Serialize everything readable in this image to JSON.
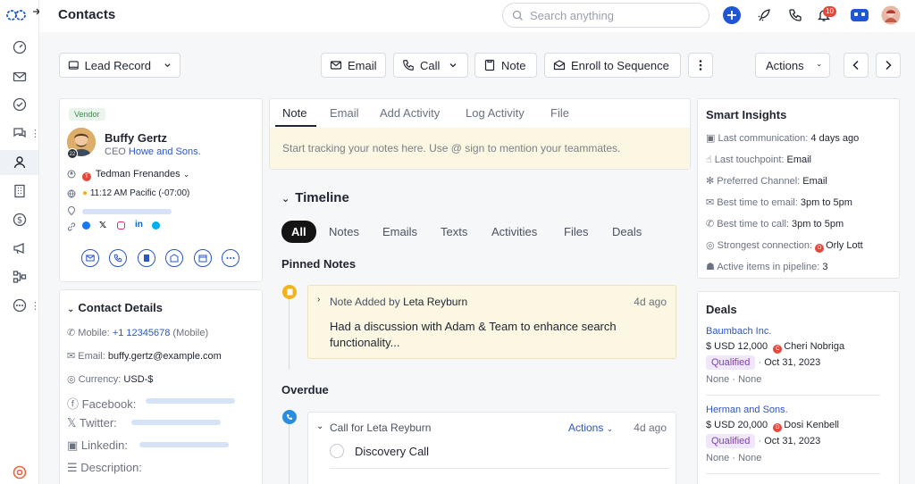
{
  "topbar": {
    "title": "Contacts",
    "search_placeholder": "Search anything",
    "notification_count": "10"
  },
  "actions": {
    "record_type": "Lead Record",
    "email": "Email",
    "call": "Call",
    "note": "Note",
    "enroll": "Enroll to Sequence",
    "actions": "Actions"
  },
  "contact": {
    "tag": "Vendor",
    "name": "Buffy Gertz",
    "title_prefix": "CEO",
    "company": "Howe and Sons.",
    "avatar_badge": "22",
    "owner_initial": "T",
    "owner": "Tedman Frenandes",
    "local_time": "11:12 AM Pacific (-07:00)"
  },
  "details": {
    "heading": "Contact Details",
    "mobile_label": "Mobile:",
    "mobile_value": "+1 12345678",
    "mobile_type": "(Mobile)",
    "email_label": "Email:",
    "email_value": "buffy.gertz@example.com",
    "currency_label": "Currency:",
    "currency_value": "USD-$",
    "facebook_label": "Facebook:",
    "twitter_label": "Twitter:",
    "linkedin_label": "Linkedin:",
    "description_label": "Description:"
  },
  "composer": {
    "tabs": [
      "Note",
      "Email",
      "Add Activity",
      "Log Activity",
      "File"
    ],
    "placeholder": "Start tracking your notes here. Use @ sign to mention your teammates."
  },
  "timeline": {
    "heading": "Timeline",
    "filters": [
      "All",
      "Notes",
      "Emails",
      "Texts",
      "Activities",
      "Files",
      "Deals"
    ],
    "pinned_heading": "Pinned Notes",
    "pinned_prefix": "Note Added by",
    "pinned_author": "Leta Reyburn",
    "pinned_time": "4d ago",
    "pinned_body": "Had a discussion with Adam & Team to enhance search functionality...",
    "overdue_heading": "Overdue",
    "overdue_title": "Call for Leta Reyburn",
    "overdue_actions": "Actions",
    "overdue_time": "4d ago",
    "overdue_task": "Discovery Call"
  },
  "insights": {
    "heading": "Smart Insights",
    "rows": [
      {
        "label": "Last communication:",
        "value": "4 days ago"
      },
      {
        "label": "Last touchpoint:",
        "value": "Email"
      },
      {
        "label": "Preferred Channel:",
        "value": "Email"
      },
      {
        "label": "Best time to email:",
        "value": "3pm to 5pm"
      },
      {
        "label": "Best time to call:",
        "value": "3pm to 5pm"
      },
      {
        "label": "Strongest connection:",
        "value": "Orly Lott",
        "initial": "O"
      },
      {
        "label": "Active items in pipeline:",
        "value": "3"
      }
    ]
  },
  "deals": {
    "heading": "Deals",
    "items": [
      {
        "name": "Baumbach Inc.",
        "amount": "$ USD 12,000",
        "owner_initial": "C",
        "owner": "Cheri Nobriga",
        "stage": "Qualified",
        "date": "Oct 31, 2023",
        "f1": "None",
        "f2": "None"
      },
      {
        "name": "Herman and Sons.",
        "amount": "$ USD 20,000",
        "owner_initial": "D",
        "owner": "Dosi Kenbell",
        "stage": "Qualified",
        "date": "Oct 31, 2023",
        "f1": "None",
        "f2": "None"
      }
    ]
  },
  "colors": {
    "accent": "#2a56c6",
    "brand_blue": "#1f56d6",
    "note_bg": "#fbf7e2",
    "qualified_bg": "#f1e7fb"
  }
}
